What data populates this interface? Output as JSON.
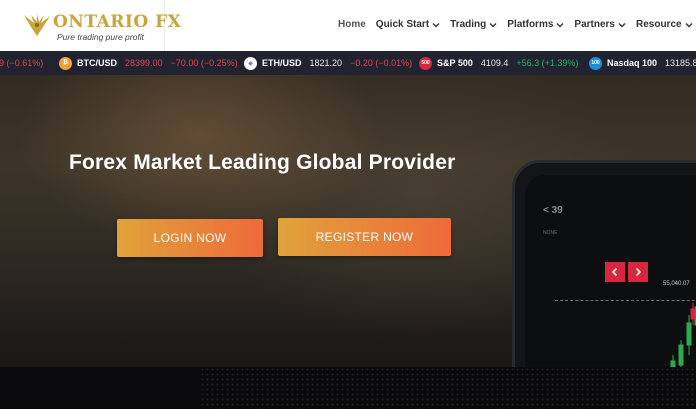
{
  "brand": {
    "name": "ONTARIO FX",
    "tagline": "Pure trading pure profit",
    "color": "#caa33a"
  },
  "nav": {
    "items": [
      {
        "label": "Home",
        "dropdown": false
      },
      {
        "label": "Quick Start",
        "dropdown": true
      },
      {
        "label": "Trading",
        "dropdown": true
      },
      {
        "label": "Platforms",
        "dropdown": true
      },
      {
        "label": "Partners",
        "dropdown": true
      },
      {
        "label": "Resource",
        "dropdown": true
      }
    ]
  },
  "ticker": [
    {
      "symbol": "",
      "price": "",
      "change": "9 (−0.61%)",
      "direction": "neg",
      "icon": "partial"
    },
    {
      "symbol": "BTC/USD",
      "price": "28399.00",
      "change": "−70.00 (−0.25%)",
      "direction": "neg",
      "icon": "bitcoin-icon",
      "icon_text": "₿",
      "icon_color": "#f2a23a"
    },
    {
      "symbol": "ETH/USD",
      "price": "1821.20",
      "change": "−0.20 (−0.01%)",
      "direction": "neg",
      "icon": "ethereum-icon",
      "icon_text": "◆",
      "icon_color": "#ffffff"
    },
    {
      "symbol": "S&P 500",
      "price": "4109.4",
      "change": "+56.3 (+1.39%)",
      "direction": "pos",
      "icon": "sp500-icon",
      "icon_text": "500",
      "icon_color": "#d7263d"
    },
    {
      "symbol": "Nasdaq 100",
      "price": "13185.8",
      "change": "",
      "direction": "plain",
      "icon": "nasdaq-icon",
      "icon_text": "100",
      "icon_color": "#1d8ed8"
    }
  ],
  "hero": {
    "title": "Forex Market Leading Global Provider",
    "login_label": "LOGIN NOW",
    "register_label": "REGISTER NOW",
    "accent_start": "#e0a23a",
    "accent_end": "#ef6a3a"
  },
  "phone": {
    "back_label": "< 39",
    "sub_label": "NONE",
    "price_label": "55,040.07"
  },
  "slider": {
    "prev_icon": "chevron-left-icon",
    "next_icon": "chevron-right-icon",
    "color": "#d7263d"
  }
}
